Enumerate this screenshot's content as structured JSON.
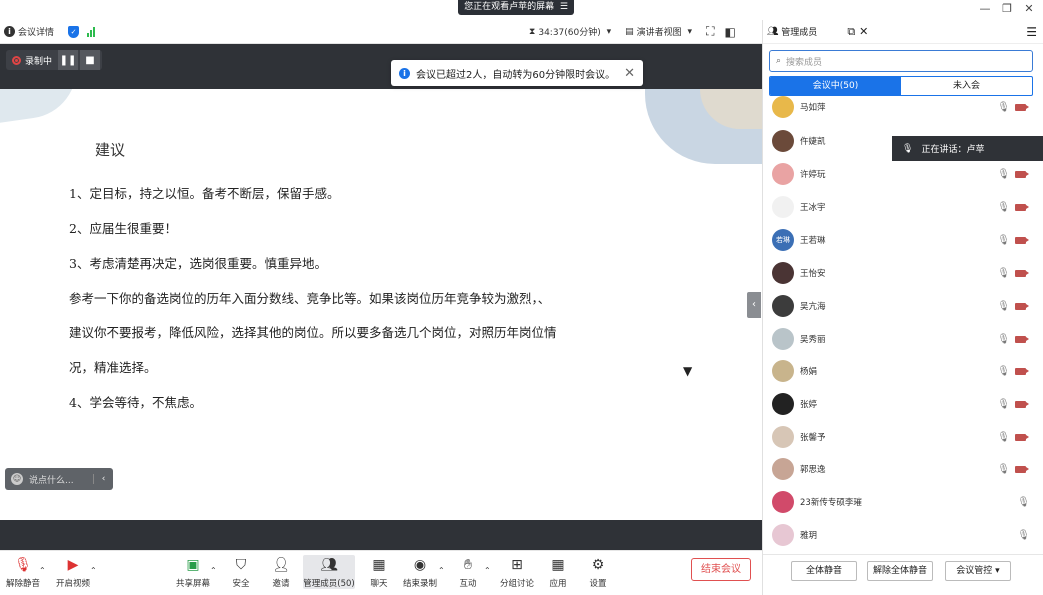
{
  "banner": {
    "text": "您正在观看卢苹的屏幕",
    "menu_icon": "menu-icon"
  },
  "window": {
    "minimize": "—",
    "restore": "❐",
    "close": "✕"
  },
  "topbar": {
    "meeting_details": "会议详情",
    "timer": "34:37(60分钟)",
    "view_mode": "演讲者视图"
  },
  "recording": {
    "label": "录制中"
  },
  "notice": {
    "text": "会议已超过2人，自动转为60分钟限时会议。"
  },
  "slide": {
    "title": "建议",
    "lines": [
      "1、定目标，持之以恒。备考不断层，保留手感。",
      "2、应届生很重要！",
      "3、考虑清楚再决定，选岗很重要。慎重异地。",
      "参考一下你的备选岗位的历年入面分数线、竞争比等。如果该岗位历年竞争较为激烈，、",
      "建议你不要报考，降低风险，选择其他的岗位。所以要多备选几个岗位，对照历年岗位情",
      "况，精准选择。",
      "4、学会等待，不焦虑。"
    ]
  },
  "chat": {
    "placeholder": "说点什么..."
  },
  "bottombar": {
    "buttons": [
      {
        "label": "解除静音"
      },
      {
        "label": "开启视频"
      },
      {
        "label": "共享屏幕"
      },
      {
        "label": "安全"
      },
      {
        "label": "邀请"
      },
      {
        "label": "管理成员(50)"
      },
      {
        "label": "聊天"
      },
      {
        "label": "结束录制"
      },
      {
        "label": "互动"
      },
      {
        "label": "分组讨论"
      },
      {
        "label": "应用"
      },
      {
        "label": "设置"
      }
    ],
    "end_meeting": "结束会议"
  },
  "panel": {
    "title": "管理成员",
    "search_placeholder": "搜索成员",
    "tab_in_meeting": "会议中(50)",
    "tab_not_joined": "未入会",
    "speaking_label": "正在讲话：卢苹",
    "members": [
      {
        "name": "马如萍",
        "color": "#e8b84a"
      },
      {
        "name": "仵婕凯",
        "color": "#6b4a3a"
      },
      {
        "name": "许婷玩",
        "color": "#e9a3a3"
      },
      {
        "name": "王冰宇",
        "color": "#f1f1f1"
      },
      {
        "name": "王若琳",
        "color": "#3b6fb5",
        "initials": "若琳"
      },
      {
        "name": "王怡安",
        "color": "#4a3434"
      },
      {
        "name": "吴亢海",
        "color": "#3c3c3c"
      },
      {
        "name": "吴秀丽",
        "color": "#b9c4c9"
      },
      {
        "name": "杨娟",
        "color": "#c8b48c"
      },
      {
        "name": "张婷",
        "color": "#222222"
      },
      {
        "name": "张馨予",
        "color": "#d7c6b6"
      },
      {
        "name": "郭思逸",
        "color": "#c7a595"
      },
      {
        "name": "23新传专硕李璀",
        "color": "#d14a6a"
      },
      {
        "name": "雅玥",
        "color": "#e7c7d3"
      }
    ],
    "footer": {
      "mute_all": "全体静音",
      "unmute_all": "解除全体静音",
      "meeting_control": "会议管控"
    }
  }
}
